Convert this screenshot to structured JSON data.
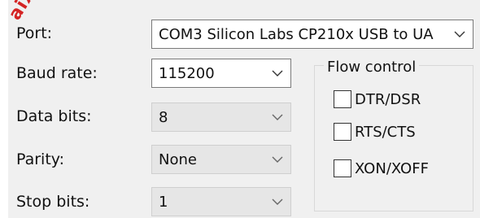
{
  "watermark": "aiXe",
  "port": {
    "label": "Port:",
    "value": "COM3 Silicon Labs CP210x USB to UA"
  },
  "baud_rate": {
    "label": "Baud rate:",
    "value": "115200"
  },
  "data_bits": {
    "label": "Data bits:",
    "value": "8"
  },
  "parity": {
    "label": "Parity:",
    "value": "None"
  },
  "stop_bits": {
    "label": "Stop bits:",
    "value": "1"
  },
  "flow_control": {
    "title": "Flow control",
    "options": [
      {
        "label": "DTR/DSR",
        "checked": false
      },
      {
        "label": "RTS/CTS",
        "checked": false
      },
      {
        "label": "XON/XOFF",
        "checked": false
      }
    ]
  },
  "icons": {
    "dropdown": "chevron-down-icon"
  },
  "colors": {
    "panel_bg": "#f0f0f0",
    "disabled_field_bg": "#e6e6e6",
    "watermark": "#d42424"
  }
}
